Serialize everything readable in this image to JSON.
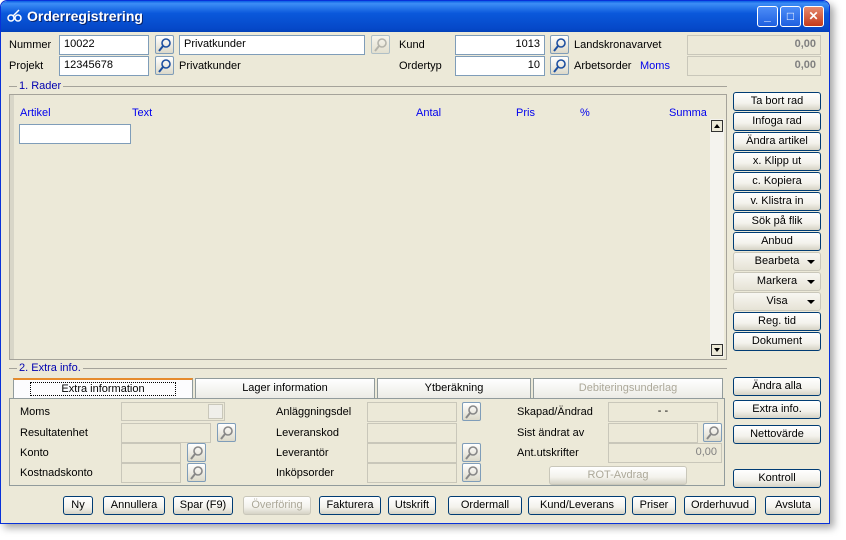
{
  "window": {
    "title": "Orderregistrering"
  },
  "header": {
    "nummer_label": "Nummer",
    "nummer_value": "10022",
    "nummer_name": "Privatkunder",
    "projekt_label": "Projekt",
    "projekt_value": "12345678",
    "projekt_name": "Privatkunder",
    "kund_label": "Kund",
    "kund_value": "1013",
    "kund_name": "Landskronavarvet",
    "kund_amount": "0,00",
    "ordertyp_label": "Ordertyp",
    "ordertyp_value": "10",
    "arbetsorder_label": "Arbetsorder",
    "moms_link": "Moms",
    "moms_amount": "0,00"
  },
  "rows_section": {
    "title": "1. Rader",
    "columns": [
      "Artikel",
      "Text",
      "Antal",
      "Pris",
      "%",
      "Summa"
    ]
  },
  "side_buttons": [
    {
      "label": "Ta bort rad"
    },
    {
      "label": "Infoga rad"
    },
    {
      "label": "Ändra artikel"
    },
    {
      "label": "x. Klipp ut"
    },
    {
      "label": "c. Kopiera"
    },
    {
      "label": "v. Klistra in"
    },
    {
      "label": "Sök på flik"
    },
    {
      "label": "Anbud"
    },
    {
      "label": "Bearbeta"
    },
    {
      "label": "Markera"
    },
    {
      "label": "Visa"
    },
    {
      "label": "Reg. tid"
    },
    {
      "label": "Dokument"
    }
  ],
  "extra_section": {
    "title": "2. Extra info.",
    "tabs": [
      "Extra information",
      "Lager information",
      "Ytberäkning",
      "Debiteringsunderlag"
    ],
    "fields": {
      "moms": "Moms",
      "resultatenhet": "Resultatenhet",
      "konto": "Konto",
      "kostnadskonto": "Kostnadskonto",
      "anlaggningsdel": "Anläggningsdel",
      "leveranskod": "Leveranskod",
      "leverantor": "Leverantör",
      "inkopsorder": "Inköpsorder",
      "skapad": "Skapad/Ändrad",
      "skapad_value": "- -",
      "sist_andrat": "Sist ändrat av",
      "ant_utskrifter": "Ant.utskrifter",
      "ant_utskrifter_value": "0,00",
      "rot": "ROT-Avdrag"
    },
    "side_buttons": [
      {
        "label": "Ändra alla"
      },
      {
        "label": "Extra info."
      },
      {
        "label": "Nettovärde"
      },
      {
        "label": "Kontroll"
      }
    ]
  },
  "bottom_buttons": [
    {
      "label": "Ny"
    },
    {
      "label": "Annullera"
    },
    {
      "label": "Spar (F9)"
    },
    {
      "label": "Överföring"
    },
    {
      "label": "Fakturera"
    },
    {
      "label": "Utskrift"
    },
    {
      "label": "Ordermall"
    },
    {
      "label": "Kund/Leverans"
    },
    {
      "label": "Priser"
    },
    {
      "label": "Orderhuvud"
    },
    {
      "label": "Avsluta"
    }
  ]
}
